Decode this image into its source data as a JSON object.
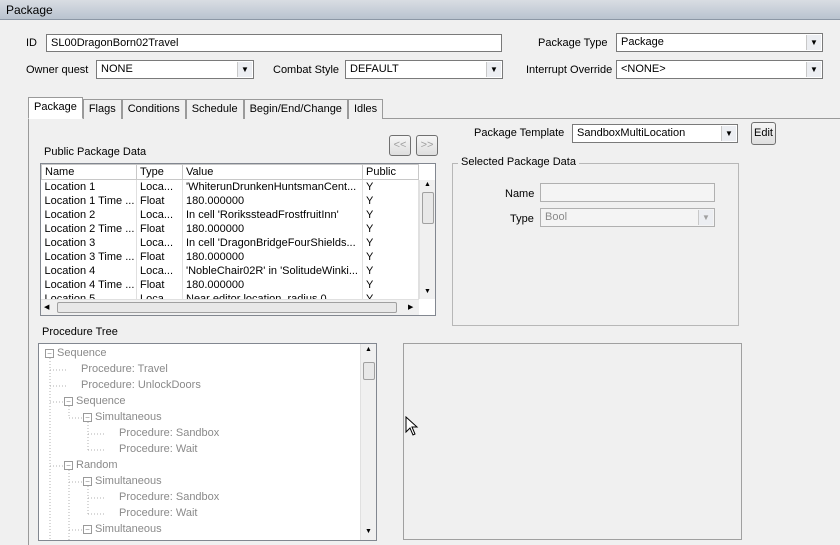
{
  "window": {
    "title": "Package"
  },
  "form": {
    "id_label": "ID",
    "id_value": "SL00DragonBorn02Travel",
    "package_type_label": "Package Type",
    "package_type_value": "Package",
    "owner_quest_label": "Owner quest",
    "owner_quest_value": "NONE",
    "combat_style_label": "Combat Style",
    "combat_style_value": "DEFAULT",
    "interrupt_override_label": "Interrupt Override",
    "interrupt_override_value": "<NONE>"
  },
  "tabs": [
    {
      "label": "Package"
    },
    {
      "label": "Flags"
    },
    {
      "label": "Conditions"
    },
    {
      "label": "Schedule"
    },
    {
      "label": "Begin/End/Change"
    },
    {
      "label": "Idles"
    }
  ],
  "template": {
    "label": "Package Template",
    "value": "SandboxMultiLocation",
    "edit_label": "Edit"
  },
  "nav": {
    "prev": "<<",
    "next": ">>"
  },
  "public_data": {
    "title": "Public Package Data",
    "columns": [
      "Name",
      "Type",
      "Value",
      "Public"
    ],
    "rows": [
      [
        "Location 1",
        "Loca...",
        "'WhiterunDrunkenHuntsmanCent...",
        "Y"
      ],
      [
        "Location 1 Time ...",
        "Float",
        "180.000000",
        "Y"
      ],
      [
        "Location 2",
        "Loca...",
        "In cell 'RorikssteadFrostfruitInn'",
        "Y"
      ],
      [
        "Location 2 Time ...",
        "Float",
        "180.000000",
        "Y"
      ],
      [
        "Location 3",
        "Loca...",
        "In cell 'DragonBridgeFourShields...",
        "Y"
      ],
      [
        "Location 3 Time ...",
        "Float",
        "180.000000",
        "Y"
      ],
      [
        "Location 4",
        "Loca...",
        "'NobleChair02R' in 'SolitudeWinki...",
        "Y"
      ],
      [
        "Location 4 Time ...",
        "Float",
        "180.000000",
        "Y"
      ],
      [
        "Location 5",
        "Loca...",
        "Near editor location, radius 0",
        "Y"
      ]
    ]
  },
  "selected": {
    "title": "Selected Package Data",
    "name_label": "Name",
    "type_label": "Type",
    "type_value": "Bool"
  },
  "procedure_tree": {
    "title": "Procedure Tree",
    "nodes": [
      {
        "text": "Sequence",
        "depth": 0,
        "exp": "−"
      },
      {
        "text": "Procedure: Travel",
        "depth": 1,
        "exp": ""
      },
      {
        "text": "Procedure: UnlockDoors",
        "depth": 1,
        "exp": ""
      },
      {
        "text": "Sequence",
        "depth": 1,
        "exp": "−"
      },
      {
        "text": "Simultaneous",
        "depth": 2,
        "exp": "−"
      },
      {
        "text": "Procedure: Sandbox",
        "depth": 3,
        "exp": ""
      },
      {
        "text": "Procedure: Wait",
        "depth": 3,
        "exp": ""
      },
      {
        "text": "Random",
        "depth": 1,
        "exp": "−"
      },
      {
        "text": "Simultaneous",
        "depth": 2,
        "exp": "−"
      },
      {
        "text": "Procedure: Sandbox",
        "depth": 3,
        "exp": ""
      },
      {
        "text": "Procedure: Wait",
        "depth": 3,
        "exp": ""
      },
      {
        "text": "Simultaneous",
        "depth": 2,
        "exp": "−"
      }
    ]
  }
}
